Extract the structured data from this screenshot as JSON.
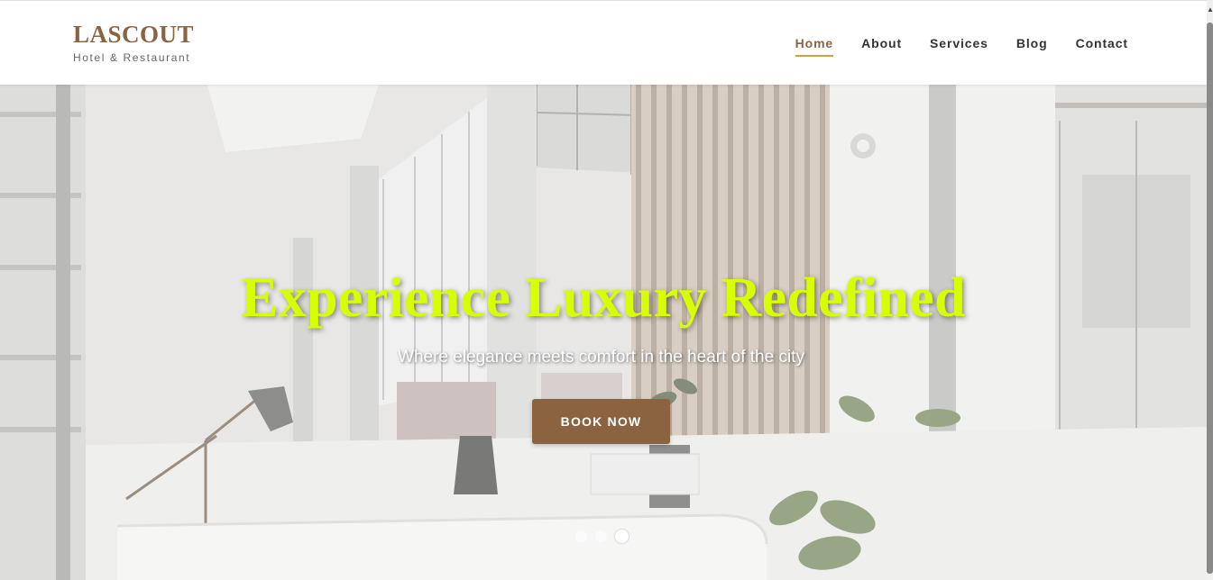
{
  "brand": {
    "name": "LASCOUT",
    "tagline": "Hotel & Restaurant"
  },
  "nav": {
    "items": [
      {
        "label": "Home",
        "active": true
      },
      {
        "label": "About",
        "active": false
      },
      {
        "label": "Services",
        "active": false
      },
      {
        "label": "Blog",
        "active": false
      },
      {
        "label": "Contact",
        "active": false
      }
    ]
  },
  "hero": {
    "title": "Experience Luxury Redefined",
    "subtitle": "Where elegance meets comfort in the heart of the city",
    "cta_label": "BOOK NOW",
    "slides": {
      "count": 3,
      "active_index": 3
    }
  },
  "colors": {
    "brand": "#8b6340",
    "accent_underline": "#c9a548",
    "title": "#d7ff00",
    "nav_text": "#333333"
  },
  "icons": {
    "scroll_up": "chevron-up-icon"
  }
}
